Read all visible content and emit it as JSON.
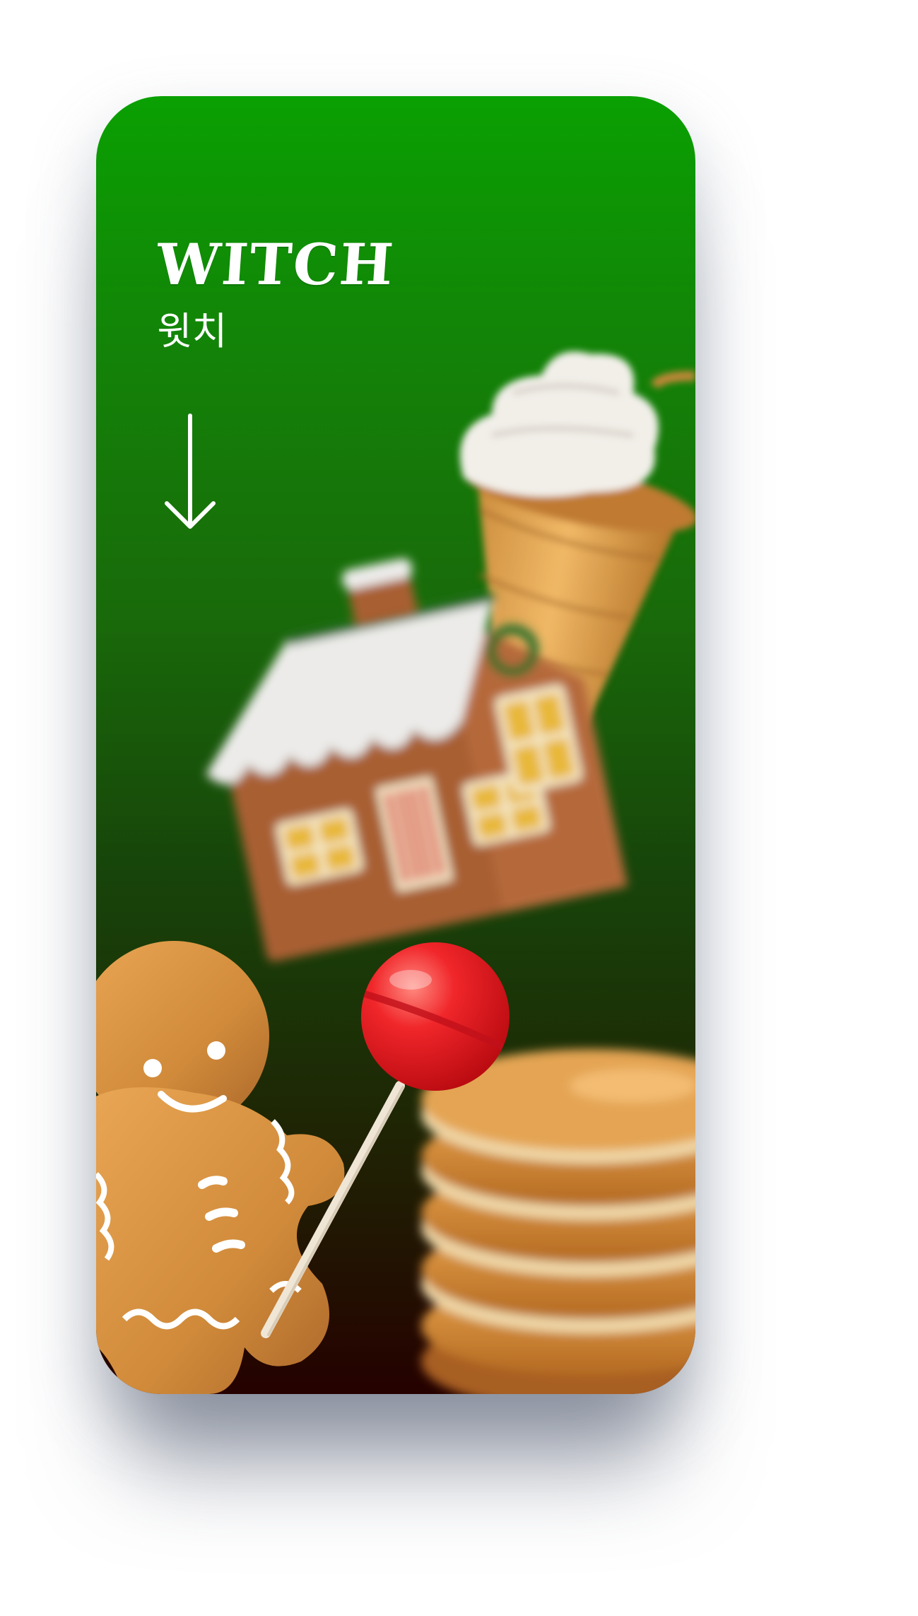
{
  "app": {
    "brand": "WITCH",
    "subtitle": "윗치"
  },
  "icons": {
    "scroll_down": "arrow-down-icon"
  },
  "colors": {
    "gradient_top": "#0aa002",
    "gradient_mid": "#17440a",
    "gradient_bottom": "#250100",
    "text": "#ffffff"
  },
  "illustrations": [
    "frappe-cup",
    "gingerbread-house",
    "gingerbread-man",
    "lollipop",
    "pancake-stack"
  ]
}
